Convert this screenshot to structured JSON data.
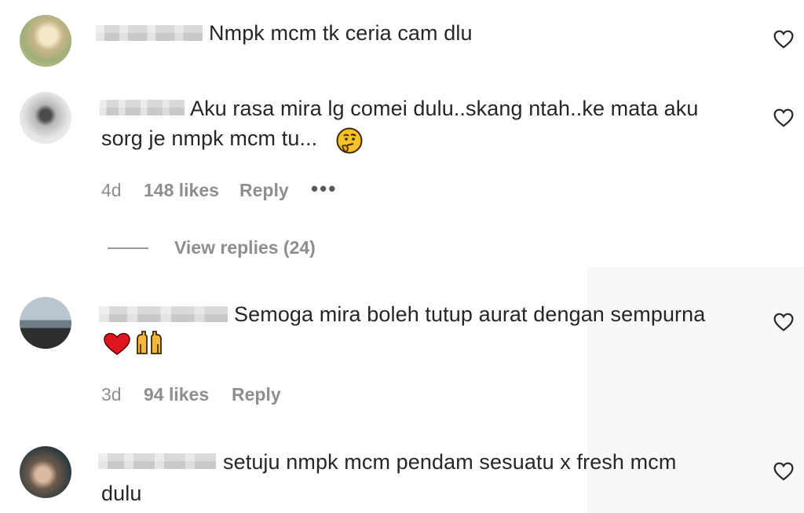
{
  "comments": [
    {
      "text": "Nmpk mcm tk ceria cam dlu"
    },
    {
      "text_line1": "Aku rasa mira lg comei dulu..skang ntah..ke mata aku",
      "text_line2": "sorg je nmpk mcm tu...",
      "emoji": "thinking-face",
      "time": "4d",
      "likes": "148 likes",
      "reply": "Reply",
      "more": "•••",
      "view_replies": "View replies (24)"
    },
    {
      "text_line1": "Semoga mira boleh tutup aurat dengan sempurna",
      "emojis": [
        "red-heart",
        "raising-hands"
      ],
      "time": "3d",
      "likes": "94 likes",
      "reply": "Reply"
    },
    {
      "text_line1": "setuju nmpk mcm pendam sesuatu x fresh mcm",
      "text_line2": "dulu"
    }
  ],
  "colors": {
    "text": "#262626",
    "muted": "#8e8e8e",
    "heart_outline": "#262626"
  }
}
